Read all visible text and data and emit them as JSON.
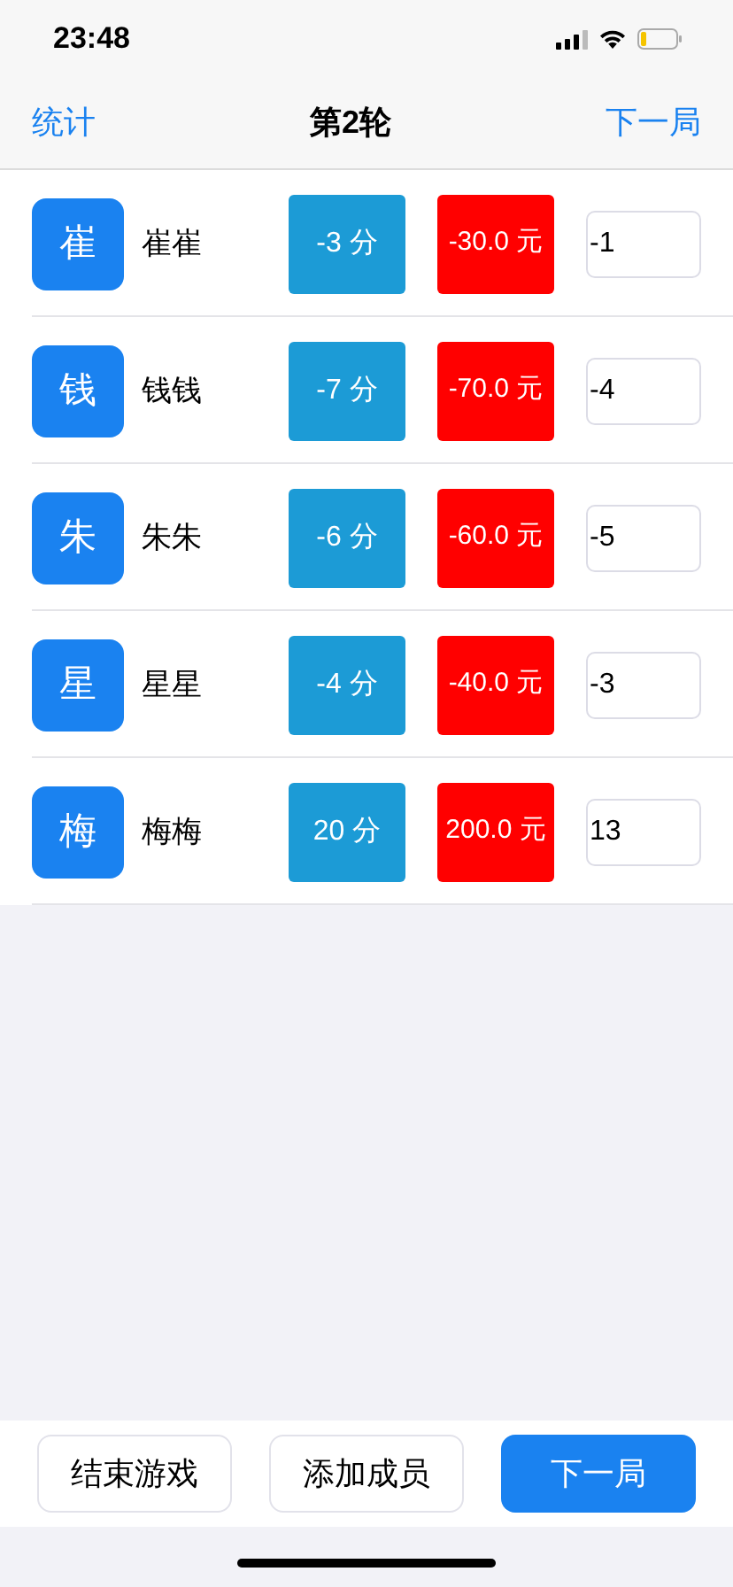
{
  "status_bar": {
    "time": "23:48"
  },
  "nav": {
    "left": "统计",
    "title": "第2轮",
    "right": "下一局"
  },
  "players": [
    {
      "avatar": "崔",
      "name": "崔崔",
      "score": "-3 分",
      "money": "-30.0 元",
      "input": "-1"
    },
    {
      "avatar": "钱",
      "name": "钱钱",
      "score": "-7 分",
      "money": "-70.0 元",
      "input": "-4"
    },
    {
      "avatar": "朱",
      "name": "朱朱",
      "score": "-6 分",
      "money": "-60.0 元",
      "input": "-5"
    },
    {
      "avatar": "星",
      "name": "星星",
      "score": "-4 分",
      "money": "-40.0 元",
      "input": "-3"
    },
    {
      "avatar": "梅",
      "name": "梅梅",
      "score": "20 分",
      "money": "200.0 元",
      "input": "13"
    }
  ],
  "buttons": [
    {
      "label": "结束游戏",
      "kind": "outline"
    },
    {
      "label": "添加成员",
      "kind": "outline"
    },
    {
      "label": "下一局",
      "kind": "primary"
    }
  ]
}
